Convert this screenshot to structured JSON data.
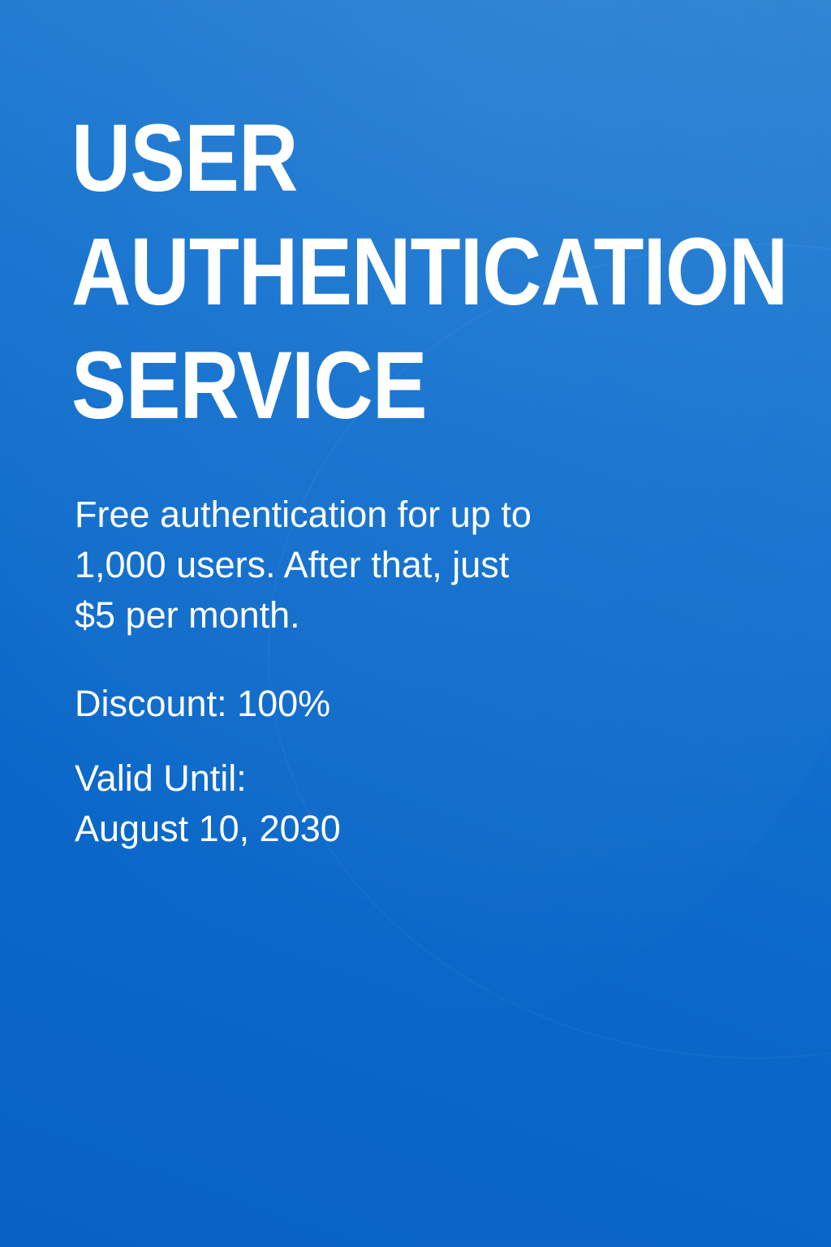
{
  "headline": {
    "lines": [
      "USER",
      "AUTHENTICATION",
      "SERVICE"
    ]
  },
  "description": {
    "lines": [
      "Free authentication for up to",
      "1,000 users. After that, just",
      "$5 per month."
    ]
  },
  "discount": {
    "text": "Discount: 100%"
  },
  "validity": {
    "label": "Valid Until:",
    "date": "August 10, 2030"
  },
  "colors": {
    "background": "#0a67c8",
    "background_top": "#2a82d2",
    "text": "#ffffff"
  }
}
